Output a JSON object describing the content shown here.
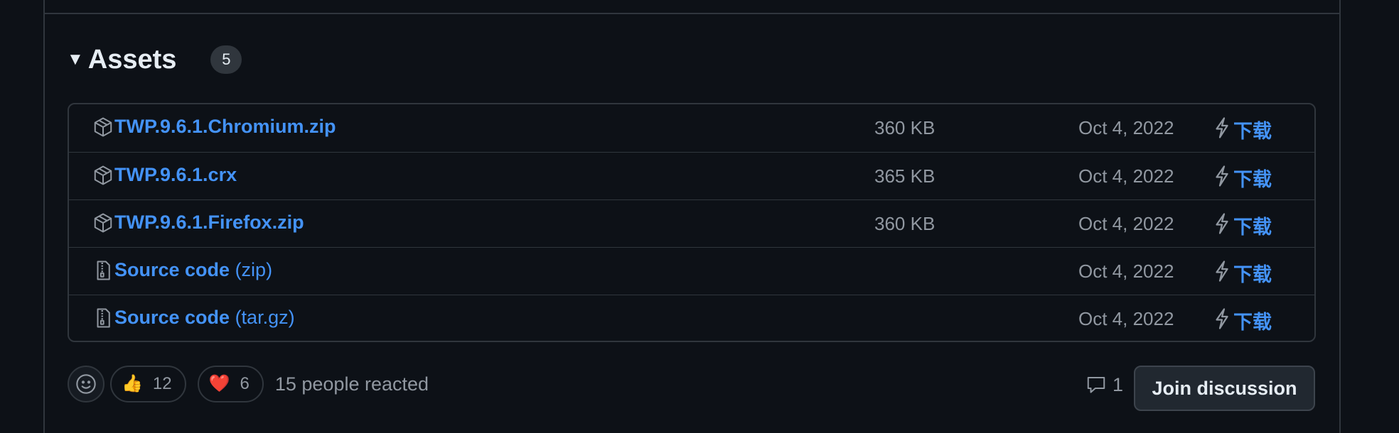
{
  "assets": {
    "title": "Assets",
    "count": "5",
    "items": [
      {
        "name": "TWP.9.6.1.Chromium.zip",
        "suffix": "",
        "icon": "package-icon",
        "size": "360 KB",
        "date": "Oct 4, 2022",
        "download": "下载"
      },
      {
        "name": "TWP.9.6.1.crx",
        "suffix": "",
        "icon": "package-icon",
        "size": "365 KB",
        "date": "Oct 4, 2022",
        "download": "下载"
      },
      {
        "name": "TWP.9.6.1.Firefox.zip",
        "suffix": "",
        "icon": "package-icon",
        "size": "360 KB",
        "date": "Oct 4, 2022",
        "download": "下载"
      },
      {
        "name": "Source code",
        "suffix": " (zip)",
        "icon": "file-zip-icon",
        "size": "",
        "date": "Oct 4, 2022",
        "download": "下载"
      },
      {
        "name": "Source code",
        "suffix": " (tar.gz)",
        "icon": "file-zip-icon",
        "size": "",
        "date": "Oct 4, 2022",
        "download": "下载"
      }
    ]
  },
  "reactions": {
    "thumbs_up": {
      "emoji": "👍",
      "count": "12"
    },
    "heart": {
      "emoji": "❤️",
      "count": "6"
    },
    "summary": "15 people reacted"
  },
  "discussion": {
    "comment_count": "1",
    "join_label": "Join discussion"
  },
  "colors": {
    "background": "#0d1117",
    "border": "#30363d",
    "link": "#4493f8",
    "muted": "#9198a1"
  }
}
